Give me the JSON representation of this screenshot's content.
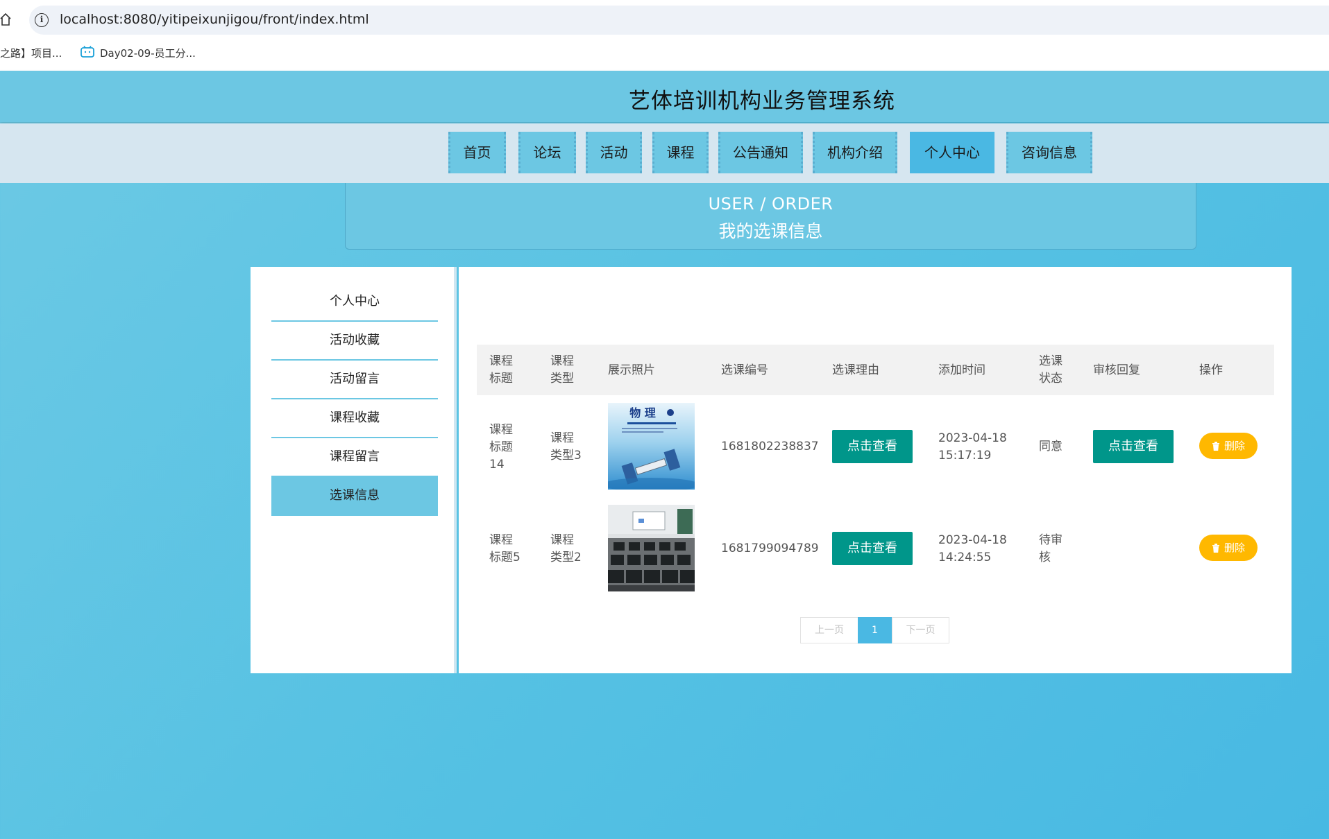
{
  "browser": {
    "url": "localhost:8080/yitipeixunjigou/front/index.html",
    "bookmarks": [
      {
        "label": "之路】项目..."
      },
      {
        "label": "Day02-09-员工分..."
      }
    ]
  },
  "app": {
    "title": "艺体培训机构业务管理系统"
  },
  "nav": {
    "items": [
      {
        "label": "首页"
      },
      {
        "label": "论坛"
      },
      {
        "label": "活动"
      },
      {
        "label": "课程"
      },
      {
        "label": "公告通知"
      },
      {
        "label": "机构介绍"
      },
      {
        "label": "个人中心",
        "active": true
      },
      {
        "label": "咨询信息"
      }
    ]
  },
  "banner": {
    "en": "USER / ORDER",
    "zh": "我的选课信息"
  },
  "sidebar": {
    "items": [
      {
        "label": "个人中心"
      },
      {
        "label": "活动收藏"
      },
      {
        "label": "活动留言"
      },
      {
        "label": "课程收藏"
      },
      {
        "label": "课程留言"
      },
      {
        "label": "选课信息",
        "active": true
      }
    ]
  },
  "table": {
    "headers": {
      "title": [
        "课程",
        "标题"
      ],
      "type": [
        "课程",
        "类型"
      ],
      "photo": "展示照片",
      "number": "选课编号",
      "reason": "选课理由",
      "time": "添加时间",
      "status": [
        "选课",
        "状态"
      ],
      "reply": "审核回复",
      "action": "操作"
    },
    "rows": [
      {
        "title": [
          "课程",
          "标题",
          "14"
        ],
        "type": [
          "课程",
          "类型3"
        ],
        "photo_icon": "physics-textbook-cover",
        "photo_text": "物 理",
        "number": "1681802238837",
        "reason_btn": "点击查看",
        "time": [
          "2023-04-18",
          "15:17:19"
        ],
        "status": [
          "同意"
        ],
        "reply_btn": "点击查看",
        "delete_btn": "删除"
      },
      {
        "title": [
          "课程",
          "标题5"
        ],
        "type": [
          "课程",
          "类型2"
        ],
        "photo_icon": "computer-classroom-photo",
        "number": "1681799094789",
        "reason_btn": "点击查看",
        "time": [
          "2023-04-18",
          "14:24:55"
        ],
        "status": [
          "待审",
          "核"
        ],
        "reply_btn": "",
        "delete_btn": "删除"
      }
    ]
  },
  "pagination": {
    "prev": "上一页",
    "current": "1",
    "next": "下一页"
  },
  "colors": {
    "primary": "#6cc7e3",
    "active": "#4ab8e3",
    "button_teal": "#00968a",
    "button_delete": "#ffb800"
  }
}
